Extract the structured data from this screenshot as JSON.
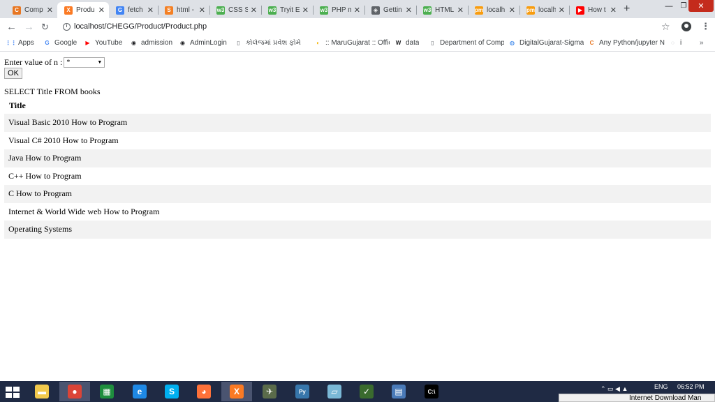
{
  "browser": {
    "tabs": [
      {
        "label": "Comp",
        "favicon": "chegg-icon",
        "color": "#e87722",
        "glyph": "C"
      },
      {
        "label": "Produ",
        "favicon": "xampp-icon",
        "color": "#fb7a24",
        "glyph": "X",
        "active": true
      },
      {
        "label": "fetch",
        "favicon": "google-icon",
        "color": "#4285f4",
        "glyph": "G"
      },
      {
        "label": "html -",
        "favicon": "stackoverflow-icon",
        "color": "#f48024",
        "glyph": "S"
      },
      {
        "label": "CSS St",
        "favicon": "w3schools-icon",
        "color": "#4caf50",
        "glyph": "w3"
      },
      {
        "label": "Tryit E",
        "favicon": "w3schools-icon",
        "color": "#4caf50",
        "glyph": "w3"
      },
      {
        "label": "PHP m",
        "favicon": "w3schools-icon",
        "color": "#4caf50",
        "glyph": "w3"
      },
      {
        "label": "Gettin",
        "favicon": "compass-icon",
        "color": "#5f6368",
        "glyph": "◈"
      },
      {
        "label": "HTML",
        "favicon": "w3schools-icon",
        "color": "#4caf50",
        "glyph": "w3"
      },
      {
        "label": "localh",
        "favicon": "phpmyadmin-icon",
        "color": "#f89c0e",
        "glyph": "pm"
      },
      {
        "label": "localh",
        "favicon": "phpmyadmin-icon",
        "color": "#f89c0e",
        "glyph": "pm"
      },
      {
        "label": "How t",
        "favicon": "youtube-icon",
        "color": "#ff0000",
        "glyph": "▶"
      }
    ],
    "url": "localhost/CHEGG/Product/Product.php",
    "bookmarks": [
      {
        "label": "Apps",
        "icon": "apps-grid-icon",
        "color": "#4285f4",
        "glyph": "⋮⋮"
      },
      {
        "label": "Google",
        "icon": "google-icon",
        "color": "#4285f4",
        "glyph": "G"
      },
      {
        "label": "YouTube",
        "icon": "youtube-icon",
        "color": "#ff0000",
        "glyph": "▶"
      },
      {
        "label": "admission",
        "icon": "globe-icon",
        "color": "#202124",
        "glyph": "◉"
      },
      {
        "label": "AdminLogin",
        "icon": "globe-icon",
        "color": "#202124",
        "glyph": "◉"
      },
      {
        "label": "કોલેજમાં પ્રવેશ ફોર્મ",
        "icon": "page-icon",
        "color": "#5f6368",
        "glyph": "▯"
      },
      {
        "label": ":: MaruGujarat :: Offic",
        "icon": "marugujarat-icon",
        "color": "#f4b400",
        "glyph": "◐"
      },
      {
        "label": "data",
        "icon": "wikipedia-icon",
        "color": "#202124",
        "glyph": "W"
      },
      {
        "label": "Department of Comp",
        "icon": "page-icon",
        "color": "#5f6368",
        "glyph": "▯"
      },
      {
        "label": "DigitalGujarat-Sigma",
        "icon": "digitalgujarat-icon",
        "color": "#1a73e8",
        "glyph": "◍"
      },
      {
        "label": "Any Python/jupyter N",
        "icon": "chegg-icon",
        "color": "#e87722",
        "glyph": "C"
      },
      {
        "label": "i",
        "icon": "extension-icon",
        "color": "#9aa0a6",
        "glyph": "◌"
      }
    ]
  },
  "page": {
    "form_label": "Enter value of n :",
    "select_value": "*",
    "ok_label": "OK",
    "query_text": "SELECT Title FROM books",
    "table": {
      "header": "Title",
      "rows": [
        "Visual Basic 2010 How to Program",
        "Visual C# 2010 How to Program",
        "Java How to Program",
        "C++ How to Program",
        "C How to Program",
        "Internet & World Wide web How to Program",
        "Operating Systems"
      ]
    }
  },
  "taskbar": {
    "apps": [
      {
        "name": "file-explorer-icon",
        "color": "#f2c94c",
        "glyph": "▬"
      },
      {
        "name": "chrome-icon",
        "color": "#db4437",
        "glyph": "●",
        "active": true
      },
      {
        "name": "store-icon",
        "color": "#1e8e3e",
        "glyph": "▦"
      },
      {
        "name": "internet-explorer-icon",
        "color": "#1e88e5",
        "glyph": "e"
      },
      {
        "name": "skype-icon",
        "color": "#00aff0",
        "glyph": "S"
      },
      {
        "name": "firefox-icon",
        "color": "#ff7139",
        "glyph": "◕"
      },
      {
        "name": "xampp-icon",
        "color": "#fb7a24",
        "glyph": "X",
        "active": true
      },
      {
        "name": "network-tool-icon",
        "color": "#5a6b4a",
        "glyph": "✈"
      },
      {
        "name": "python-icon",
        "color": "#3776ab",
        "glyph": "Py"
      },
      {
        "name": "notepad-icon",
        "color": "#7ab8d6",
        "glyph": "▱"
      },
      {
        "name": "chart-app-icon",
        "color": "#3a6b2e",
        "glyph": "✓"
      },
      {
        "name": "control-panel-icon",
        "color": "#4a7ab8",
        "glyph": "▤"
      },
      {
        "name": "command-prompt-icon",
        "color": "#000000",
        "glyph": "C:\\"
      }
    ],
    "language": "ENG",
    "time": "06:52 PM",
    "popup_text": "Internet Download Man"
  }
}
